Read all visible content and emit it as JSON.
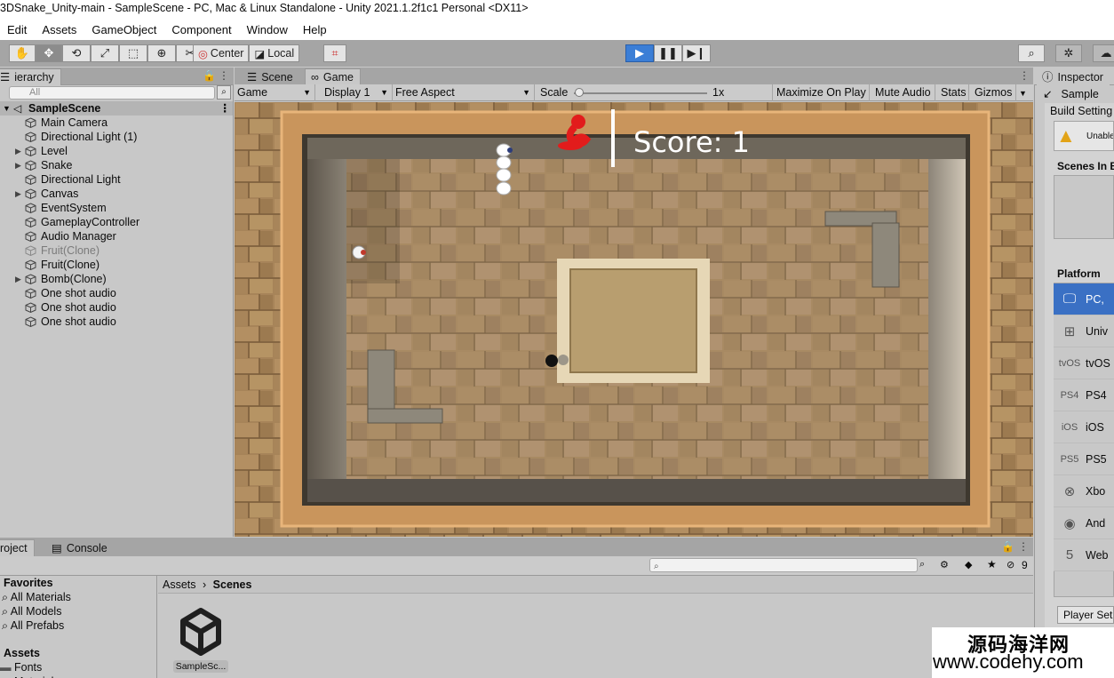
{
  "window": {
    "title": "3DSnake_Unity-main - SampleScene - PC, Mac & Linux Standalone - Unity 2021.1.2f1c1 Personal <DX11>"
  },
  "menu": [
    "Edit",
    "Assets",
    "GameObject",
    "Component",
    "Window",
    "Help"
  ],
  "toolbar": {
    "pivot_label": "Center",
    "space_label": "Local"
  },
  "hierarchy": {
    "tab_label": "ierarchy",
    "search_placeholder": "All",
    "scene_name": "SampleScene",
    "items": [
      {
        "label": "Main Camera",
        "expandable": false,
        "dim": false
      },
      {
        "label": "Directional Light (1)",
        "expandable": false,
        "dim": false
      },
      {
        "label": "Level",
        "expandable": true,
        "dim": false
      },
      {
        "label": "Snake",
        "expandable": true,
        "dim": false
      },
      {
        "label": "Directional Light",
        "expandable": false,
        "dim": false
      },
      {
        "label": "Canvas",
        "expandable": true,
        "dim": false
      },
      {
        "label": "EventSystem",
        "expandable": false,
        "dim": false
      },
      {
        "label": "GameplayController",
        "expandable": false,
        "dim": false
      },
      {
        "label": "Audio Manager",
        "expandable": false,
        "dim": false
      },
      {
        "label": "Fruit(Clone)",
        "expandable": false,
        "dim": true
      },
      {
        "label": "Fruit(Clone)",
        "expandable": false,
        "dim": false
      },
      {
        "label": "Bomb(Clone)",
        "expandable": true,
        "dim": false
      },
      {
        "label": "One shot audio",
        "expandable": false,
        "dim": false
      },
      {
        "label": "One shot audio",
        "expandable": false,
        "dim": false
      },
      {
        "label": "One shot audio",
        "expandable": false,
        "dim": false
      }
    ]
  },
  "view_tabs": {
    "scene": "Scene",
    "game": "Game"
  },
  "game_toolbar": {
    "view": "Game",
    "display": "Display 1",
    "aspect": "Free Aspect",
    "scale_label": "Scale",
    "scale_value": "1x",
    "maximize": "Maximize On Play",
    "mute": "Mute Audio",
    "stats": "Stats",
    "gizmos": "Gizmos"
  },
  "game": {
    "score_text": "Score: 1"
  },
  "inspector": {
    "tab_label": "Inspector",
    "object_name": "Sample",
    "build_settings": "Build Setting",
    "warning": "Unable",
    "scenes_in_build": "Scenes In B",
    "platform_header": "Platform",
    "platforms": [
      {
        "icon": "🖵",
        "label": "PC,",
        "selected": true
      },
      {
        "icon": "⊞",
        "label": "Univ",
        "selected": false
      },
      {
        "icon": "tvOS",
        "label": "tvOS",
        "selected": false
      },
      {
        "icon": "PS4",
        "label": "PS4",
        "selected": false
      },
      {
        "icon": "iOS",
        "label": "iOS",
        "selected": false
      },
      {
        "icon": "PS5",
        "label": "PS5",
        "selected": false
      },
      {
        "icon": "⊗",
        "label": "Xbo",
        "selected": false
      },
      {
        "icon": "◉",
        "label": "And",
        "selected": false
      },
      {
        "icon": "5",
        "label": "Web",
        "selected": false
      }
    ],
    "player_settings": "Player Set"
  },
  "project": {
    "tab_project": "roject",
    "tab_console": "Console",
    "hidden_count": "9",
    "favorites_header": "Favorites",
    "favorites": [
      "All Materials",
      "All Models",
      "All Prefabs"
    ],
    "assets_header": "Assets",
    "asset_folders": [
      "Fonts",
      "Materials"
    ],
    "breadcrumb_root": "Assets",
    "breadcrumb_current": "Scenes",
    "asset_items": [
      {
        "label": "SampleSc..."
      }
    ]
  },
  "watermark": {
    "line1": "源码海洋网",
    "line2": "www.codehy.com"
  }
}
